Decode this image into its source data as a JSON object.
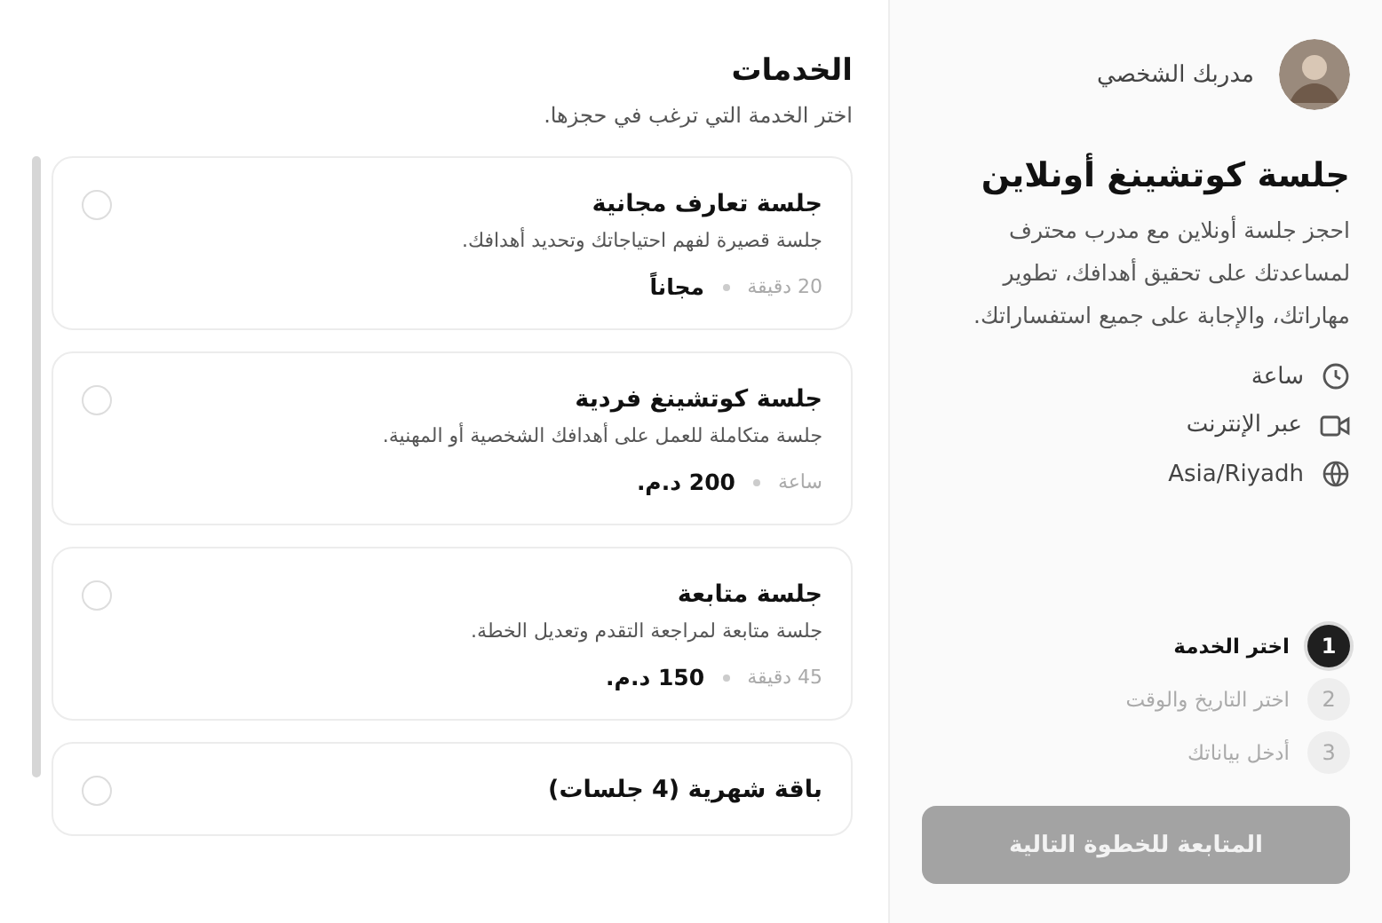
{
  "coach": {
    "label": "مدربك الشخصي"
  },
  "session": {
    "title": "جلسة كوتشينغ أونلاين",
    "description": "احجز جلسة أونلاين مع مدرب محترف لمساعدتك على تحقيق أهدافك، تطوير مهاراتك، والإجابة على جميع استفساراتك.",
    "details": [
      {
        "kind": "duration",
        "text": "ساعة"
      },
      {
        "kind": "video",
        "text": "عبر الإنترنت"
      },
      {
        "kind": "timezone",
        "text": "Asia/Riyadh"
      }
    ]
  },
  "steps": [
    {
      "number": "1",
      "label": "اختر الخدمة",
      "selected": true
    },
    {
      "number": "2",
      "label": "اختر التاريخ والوقت",
      "selected": false
    },
    {
      "number": "3",
      "label": "أدخل بياناتك",
      "selected": false
    }
  ],
  "next_button": {
    "label": "المتابعة للخطوة التالية",
    "disabled": true
  },
  "services": {
    "title": "الخدمات",
    "subtitle": "اختر الخدمة التي ترغب في حجزها.",
    "items": [
      {
        "name": "جلسة تعارف مجانية",
        "description": "جلسة قصيرة لفهم احتياجاتك وتحديد أهدافك.",
        "duration": "20 دقيقة",
        "price": "مجاناً",
        "selected": false
      },
      {
        "name": "جلسة كوتشينغ فردية",
        "description": "جلسة متكاملة للعمل على أهدافك الشخصية أو المهنية.",
        "duration": "ساعة",
        "price": "200 د.م.",
        "selected": false
      },
      {
        "name": "جلسة متابعة",
        "description": "جلسة متابعة لمراجعة التقدم وتعديل الخطة.",
        "duration": "45 دقيقة",
        "price": "150 د.م.",
        "selected": false
      },
      {
        "name": "باقة شهرية (4 جلسات)",
        "selected": false
      }
    ]
  }
}
